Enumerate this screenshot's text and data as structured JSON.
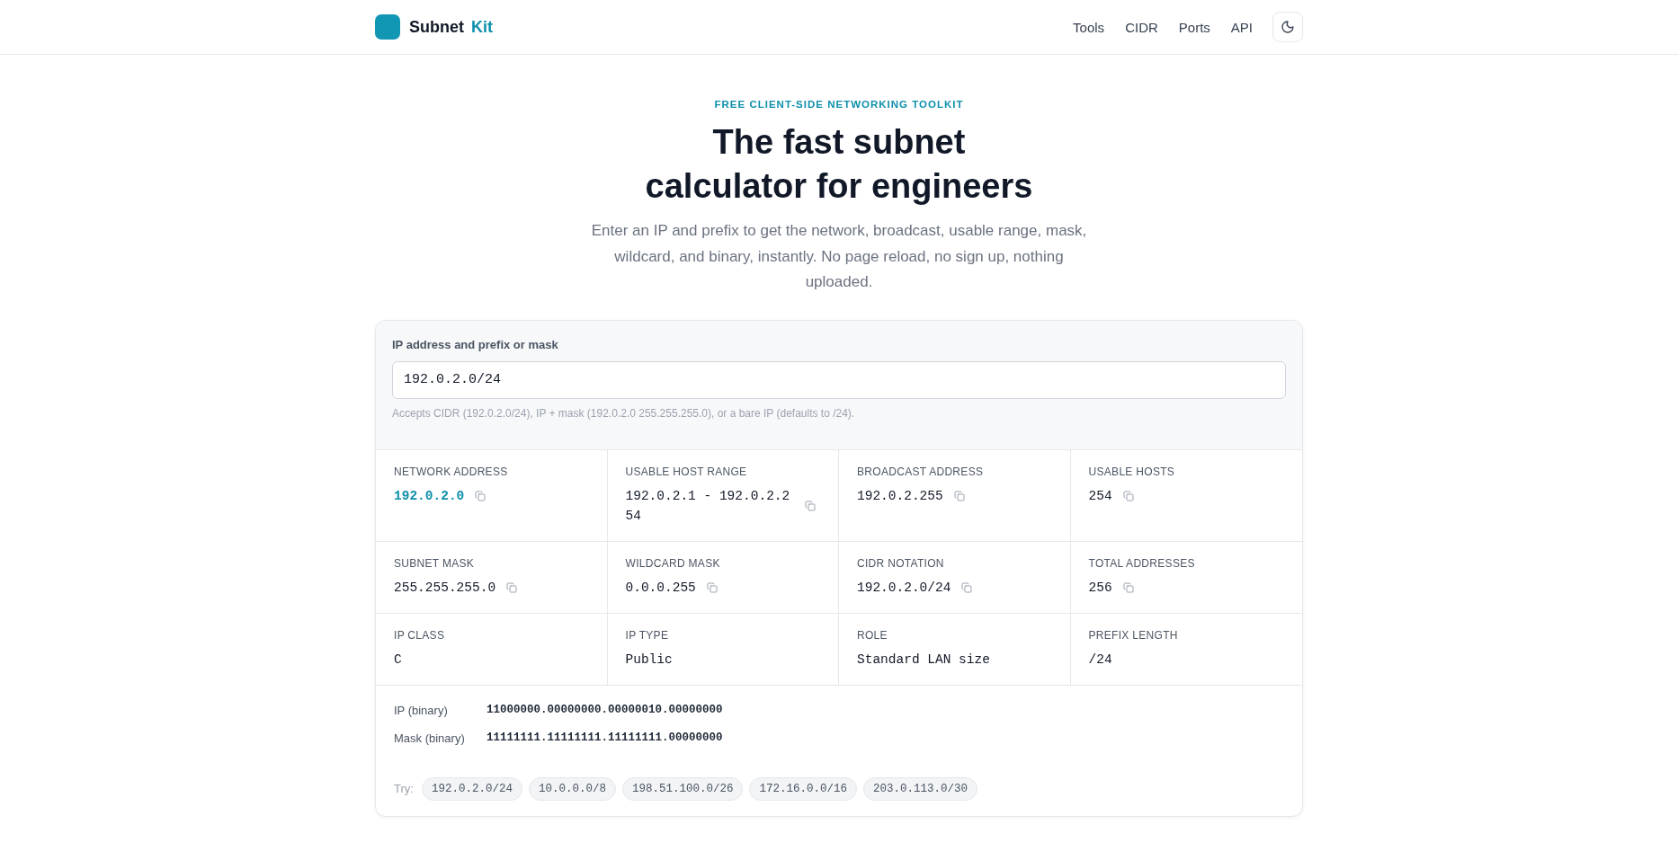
{
  "header": {
    "brand": {
      "name": "Subnet",
      "accent": "Kit"
    },
    "nav": [
      {
        "label": "Tools"
      },
      {
        "label": "CIDR"
      },
      {
        "label": "Ports"
      },
      {
        "label": "API"
      }
    ]
  },
  "hero": {
    "eyebrow": "FREE CLIENT-SIDE NETWORKING TOOLKIT",
    "title": "The fast subnet calculator for engineers",
    "subtitle": "Enter an IP and prefix to get the network, broadcast, usable range, mask, wildcard, and binary, instantly. No page reload, no sign up, nothing uploaded."
  },
  "calculator": {
    "input": {
      "label": "IP address and prefix or mask",
      "value": "192.0.2.0/24",
      "hint": "Accepts CIDR (192.0.2.0/24), IP + mask (192.0.2.0 255.255.255.0), or a bare IP (defaults to /24)."
    },
    "results": [
      {
        "label": "NETWORK ADDRESS",
        "value": "192.0.2.0",
        "emphasized": true,
        "copyable": true
      },
      {
        "label": "USABLE HOST RANGE",
        "value": "192.0.2.1 - 192.0.2.254",
        "emphasized": false,
        "copyable": true
      },
      {
        "label": "BROADCAST ADDRESS",
        "value": "192.0.2.255",
        "emphasized": false,
        "copyable": true
      },
      {
        "label": "USABLE HOSTS",
        "value": "254",
        "emphasized": false,
        "copyable": true
      },
      {
        "label": "SUBNET MASK",
        "value": "255.255.255.0",
        "emphasized": false,
        "copyable": true
      },
      {
        "label": "WILDCARD MASK",
        "value": "0.0.0.255",
        "emphasized": false,
        "copyable": true
      },
      {
        "label": "CIDR NOTATION",
        "value": "192.0.2.0/24",
        "emphasized": false,
        "copyable": true
      },
      {
        "label": "TOTAL ADDRESSES",
        "value": "256",
        "emphasized": false,
        "copyable": true
      },
      {
        "label": "IP CLASS",
        "value": "C",
        "emphasized": false,
        "copyable": false
      },
      {
        "label": "IP TYPE",
        "value": "Public",
        "emphasized": false,
        "copyable": false
      },
      {
        "label": "ROLE",
        "value": "Standard LAN size",
        "emphasized": false,
        "copyable": false
      },
      {
        "label": "PREFIX LENGTH",
        "value": "/24",
        "emphasized": false,
        "copyable": false
      }
    ],
    "binary": [
      {
        "label": "IP (binary)",
        "value": "11000000.00000000.00000010.00000000"
      },
      {
        "label": "Mask (binary)",
        "value": "11111111.11111111.11111111.00000000"
      }
    ],
    "examples": {
      "label": "Try:",
      "items": [
        "192.0.2.0/24",
        "10.0.0.0/8",
        "198.51.100.0/26",
        "172.16.0.0/16",
        "203.0.113.0/30"
      ]
    }
  }
}
